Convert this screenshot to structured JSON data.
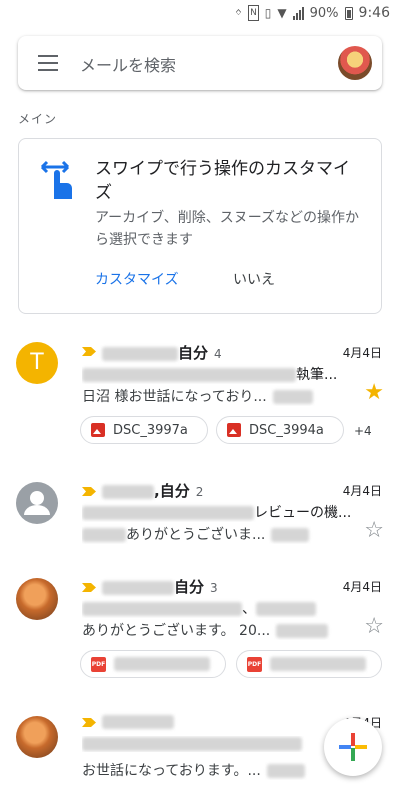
{
  "status_bar": {
    "battery": "90%",
    "time": "9:46"
  },
  "search": {
    "placeholder": "メールを検索"
  },
  "section_label": "メイン",
  "promo": {
    "title": "スワイプで行う操作のカスタマイズ",
    "body": "アーカイブ、削除、スヌーズなどの操作から選択できます",
    "customize_label": "カスタマイズ",
    "dismiss_label": "いいえ"
  },
  "emails": [
    {
      "avatar_letter": "T",
      "sender_suffix": "自分",
      "count": "4",
      "date": "4月4日",
      "subject_tail": "執筆...",
      "snippet": "日沼 様お世話になっており...",
      "starred": true,
      "attachments": [
        "DSC_3997a",
        "DSC_3994a"
      ],
      "more": "+4"
    },
    {
      "sender_suffix": ",自分",
      "count": "2",
      "date": "4月4日",
      "subject_tail": "レビューの機...",
      "snippet": "ありがとうございま...",
      "starred": false
    },
    {
      "sender_suffix": "自分",
      "count": "3",
      "date": "4月4日",
      "subject_tail": "、",
      "snippet": "ありがとうございます。 20...",
      "starred": false
    },
    {
      "date": "4月4日",
      "snippet": "お世話になっております。..."
    }
  ]
}
